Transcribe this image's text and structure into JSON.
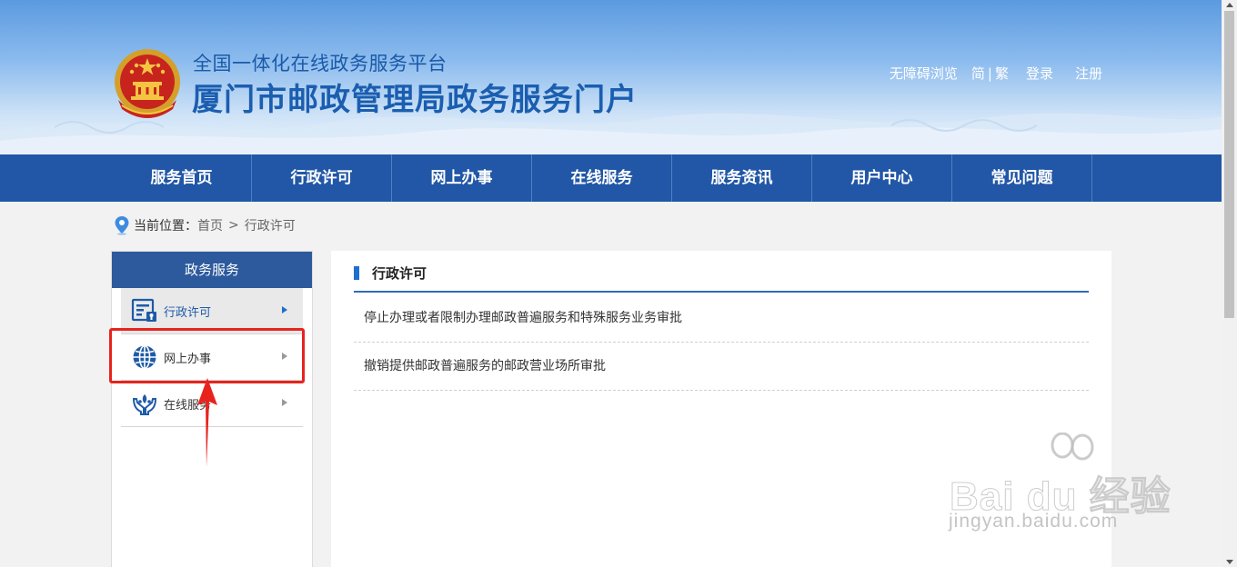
{
  "header": {
    "platform_title": "全国一体化在线政务服务平台",
    "portal_title": "厦门市邮政管理局政务服务门户",
    "top_links": {
      "accessibility": "无障碍浏览",
      "simplified": "简",
      "separator": "|",
      "traditional": "繁",
      "login": "登录",
      "register": "注册"
    }
  },
  "nav": {
    "items": [
      "服务首页",
      "行政许可",
      "网上办事",
      "在线服务",
      "服务资讯",
      "用户中心",
      "常见问题"
    ]
  },
  "breadcrumb": {
    "prefix": "当前位置：",
    "home": "首页",
    "separator": ">",
    "current": "行政许可"
  },
  "sidebar": {
    "heading": "政务服务",
    "items": [
      {
        "label": "行政许可",
        "icon": "certificate-icon",
        "active": true
      },
      {
        "label": "网上办事",
        "icon": "globe-icon",
        "active": false
      },
      {
        "label": "在线服务",
        "icon": "hands-plant-icon",
        "active": false
      }
    ]
  },
  "content": {
    "title": "行政许可",
    "items": [
      "停止办理或者限制办理邮政普遍服务和特殊服务业务审批",
      "撤销提供邮政普遍服务的邮政营业场所审批"
    ]
  },
  "watermark": {
    "brand": "Bai du 经验",
    "url": "jingyan.baidu.com"
  },
  "colors": {
    "nav_bg": "#2157a6",
    "sidebar_head_bg": "#2d5a9d",
    "accent_blue": "#1e6fd0",
    "annotation_red": "#e8231d"
  }
}
